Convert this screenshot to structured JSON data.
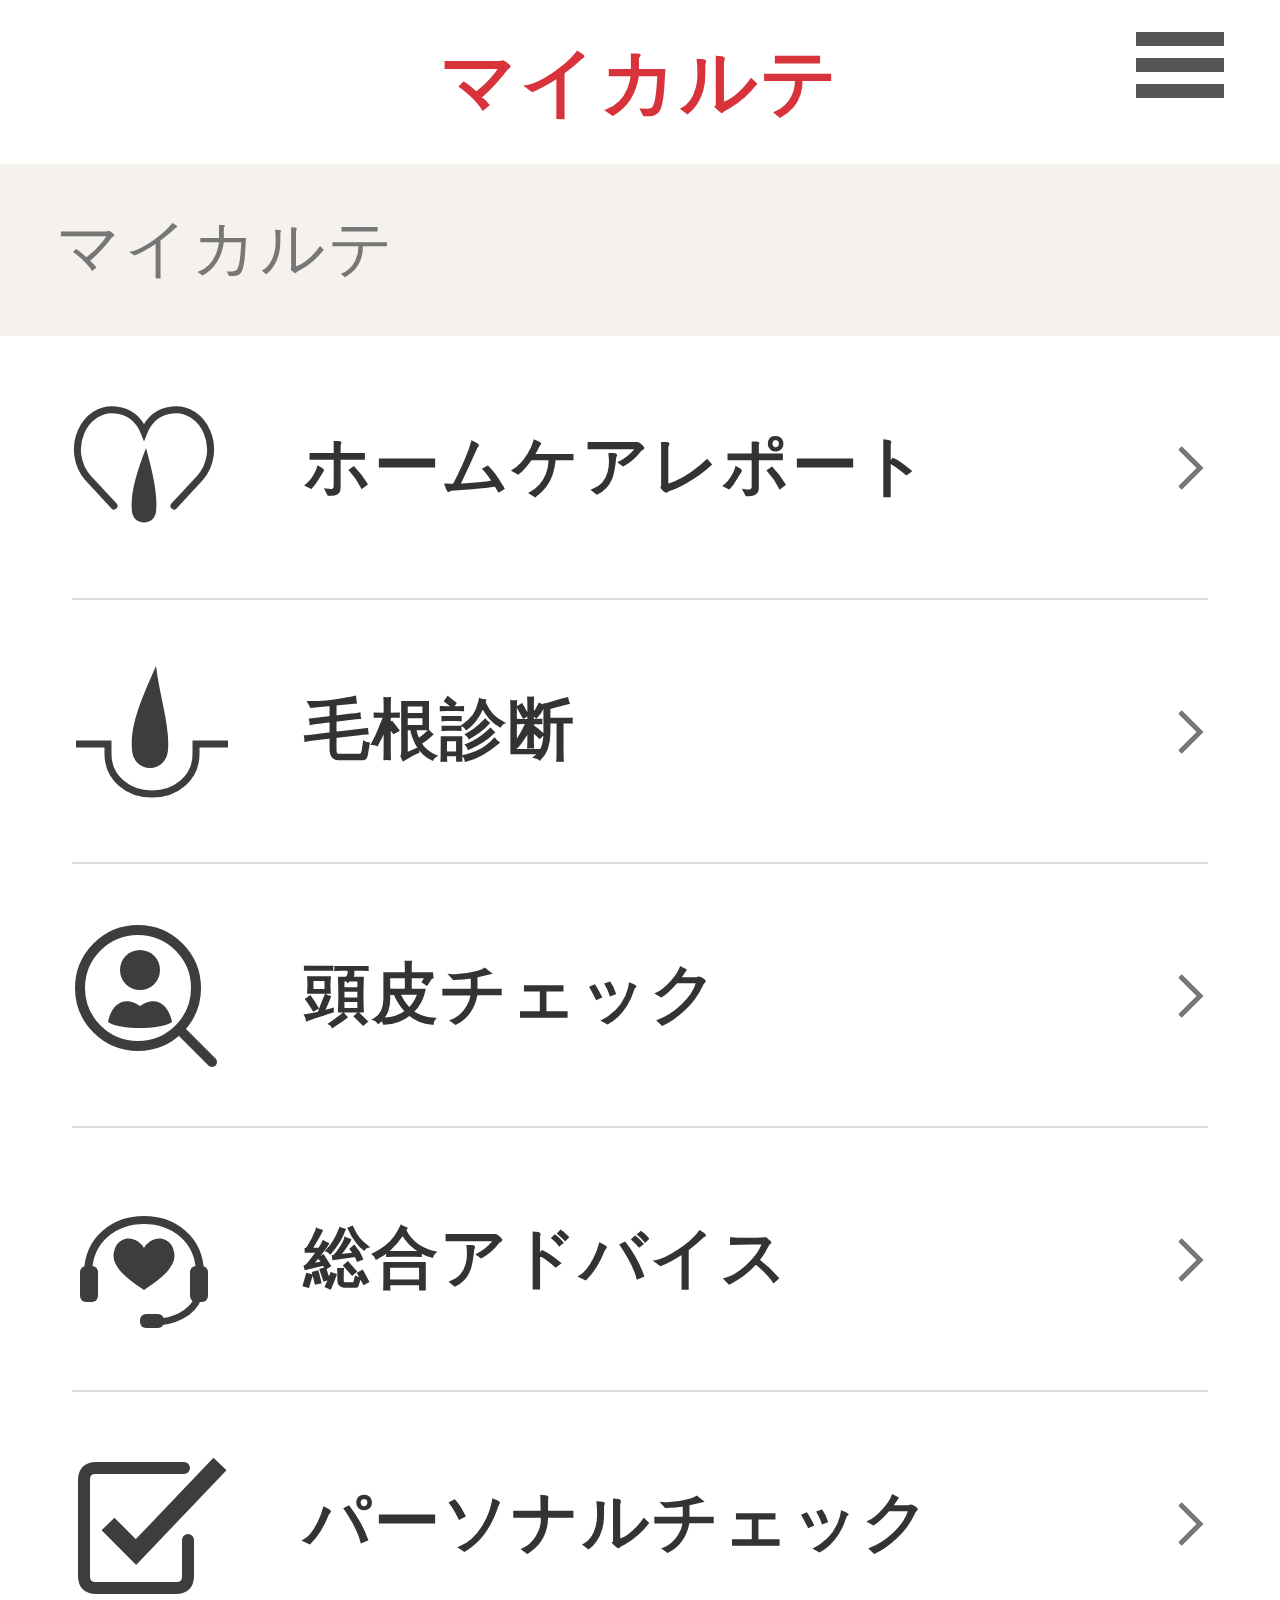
{
  "header": {
    "title": "マイカルテ"
  },
  "section": {
    "title": "マイカルテ"
  },
  "items": [
    {
      "kind": "heart-hair",
      "label": "ホームケアレポート"
    },
    {
      "kind": "hair-root",
      "label": "毛根診断"
    },
    {
      "kind": "person-search",
      "label": "頭皮チェック"
    },
    {
      "kind": "headset",
      "label": "総合アドバイス"
    },
    {
      "kind": "checkbox",
      "label": "パーソナルチェック"
    }
  ]
}
